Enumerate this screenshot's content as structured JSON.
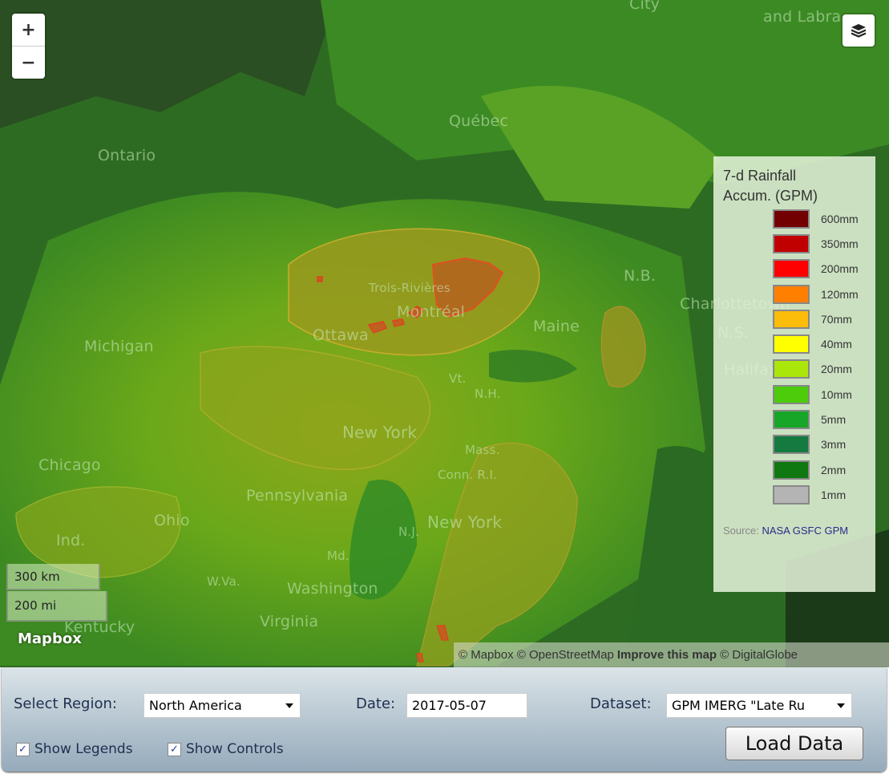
{
  "map": {
    "place_labels": [
      {
        "text": "City"
      },
      {
        "text": "and Labra"
      },
      {
        "text": "Québec"
      },
      {
        "text": "Ontario"
      },
      {
        "text": "Trois-Rivières"
      },
      {
        "text": "Montréal"
      },
      {
        "text": "Ottawa"
      },
      {
        "text": "Maine"
      },
      {
        "text": "N.B."
      },
      {
        "text": "Charlottetown"
      },
      {
        "text": "N.S."
      },
      {
        "text": "Halifax"
      },
      {
        "text": "Michigan"
      },
      {
        "text": "Vt."
      },
      {
        "text": "N.H."
      },
      {
        "text": "New York"
      },
      {
        "text": "Mass."
      },
      {
        "text": "Conn. R.I."
      },
      {
        "text": "Chicago"
      },
      {
        "text": "Pennsylvania"
      },
      {
        "text": "Ohio"
      },
      {
        "text": "Ind."
      },
      {
        "text": "New York"
      },
      {
        "text": "N.J."
      },
      {
        "text": "Md."
      },
      {
        "text": "W.Va."
      },
      {
        "text": "Washington"
      },
      {
        "text": "Virginia"
      },
      {
        "text": "Kentucky"
      }
    ],
    "zoom_in_label": "+",
    "zoom_out_label": "−",
    "layers_icon": "layers-icon",
    "scale": {
      "km": "300 km",
      "mi": "200 mi"
    },
    "logo": "Mapbox",
    "attribution": {
      "mapbox": "© Mapbox",
      "osm": "© OpenStreetMap",
      "improve": "Improve this map",
      "digitalglobe": "© DigitalGlobe"
    }
  },
  "legend": {
    "title_line1": "7-d Rainfall",
    "title_line2": "Accum. (GPM)",
    "items": [
      {
        "label": "600mm",
        "color": "#730000"
      },
      {
        "label": "350mm",
        "color": "#c00000"
      },
      {
        "label": "200mm",
        "color": "#ff0000"
      },
      {
        "label": "120mm",
        "color": "#ff8000"
      },
      {
        "label": "70mm",
        "color": "#fcbc0a"
      },
      {
        "label": "40mm",
        "color": "#ffff00"
      },
      {
        "label": "20mm",
        "color": "#aae60a"
      },
      {
        "label": "10mm",
        "color": "#4ccc0a"
      },
      {
        "label": "5mm",
        "color": "#18a628"
      },
      {
        "label": "3mm",
        "color": "#147a40"
      },
      {
        "label": "2mm",
        "color": "#107810"
      },
      {
        "label": "1mm",
        "color": "#b4b4b4"
      }
    ],
    "source_label": "Source:",
    "source_link": "NASA GSFC GPM"
  },
  "controls": {
    "region_label": "Select Region:",
    "region_value": "North America",
    "date_label": "Date:",
    "date_value": "2017-05-07",
    "dataset_label": "Dataset:",
    "dataset_value": "GPM IMERG \"Late Ru",
    "show_legends_label": "Show Legends",
    "show_legends_checked": true,
    "show_controls_label": "Show Controls",
    "show_controls_checked": true,
    "load_button": "Load Data"
  }
}
